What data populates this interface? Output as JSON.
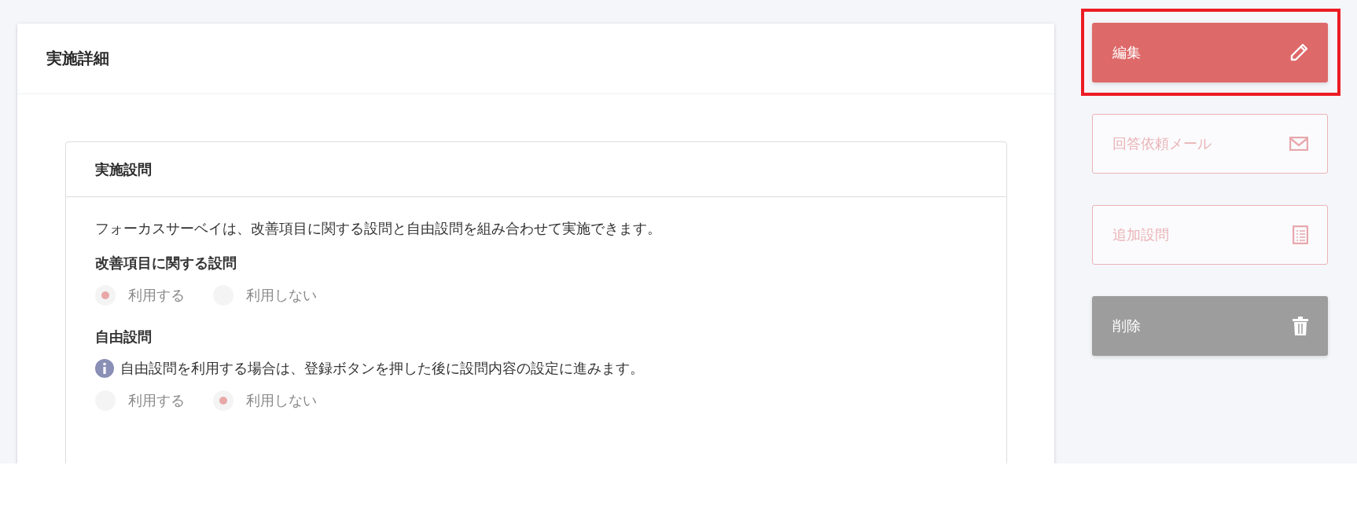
{
  "detail_card": {
    "title": "実施詳細",
    "section": {
      "title": "実施設問",
      "description": "フォーカスサーベイは、改善項目に関する設問と自由設問を組み合わせて実施できます。",
      "groups": [
        {
          "label": "改善項目に関する設問",
          "options": [
            {
              "label": "利用する",
              "selected": true
            },
            {
              "label": "利用しない",
              "selected": false
            }
          ]
        },
        {
          "label": "自由設問",
          "note": "自由設問を利用する場合は、登録ボタンを押した後に設問内容の設定に進みます。",
          "options": [
            {
              "label": "利用する",
              "selected": false
            },
            {
              "label": "利用しない",
              "selected": true
            }
          ]
        }
      ]
    }
  },
  "actions": [
    {
      "label": "編集",
      "kind": "primary",
      "highlighted": true
    },
    {
      "label": "回答依頼メール",
      "kind": "outline",
      "highlighted": false
    },
    {
      "label": "追加設問",
      "kind": "outline",
      "highlighted": false
    },
    {
      "label": "削除",
      "kind": "secondary",
      "highlighted": false
    }
  ]
}
